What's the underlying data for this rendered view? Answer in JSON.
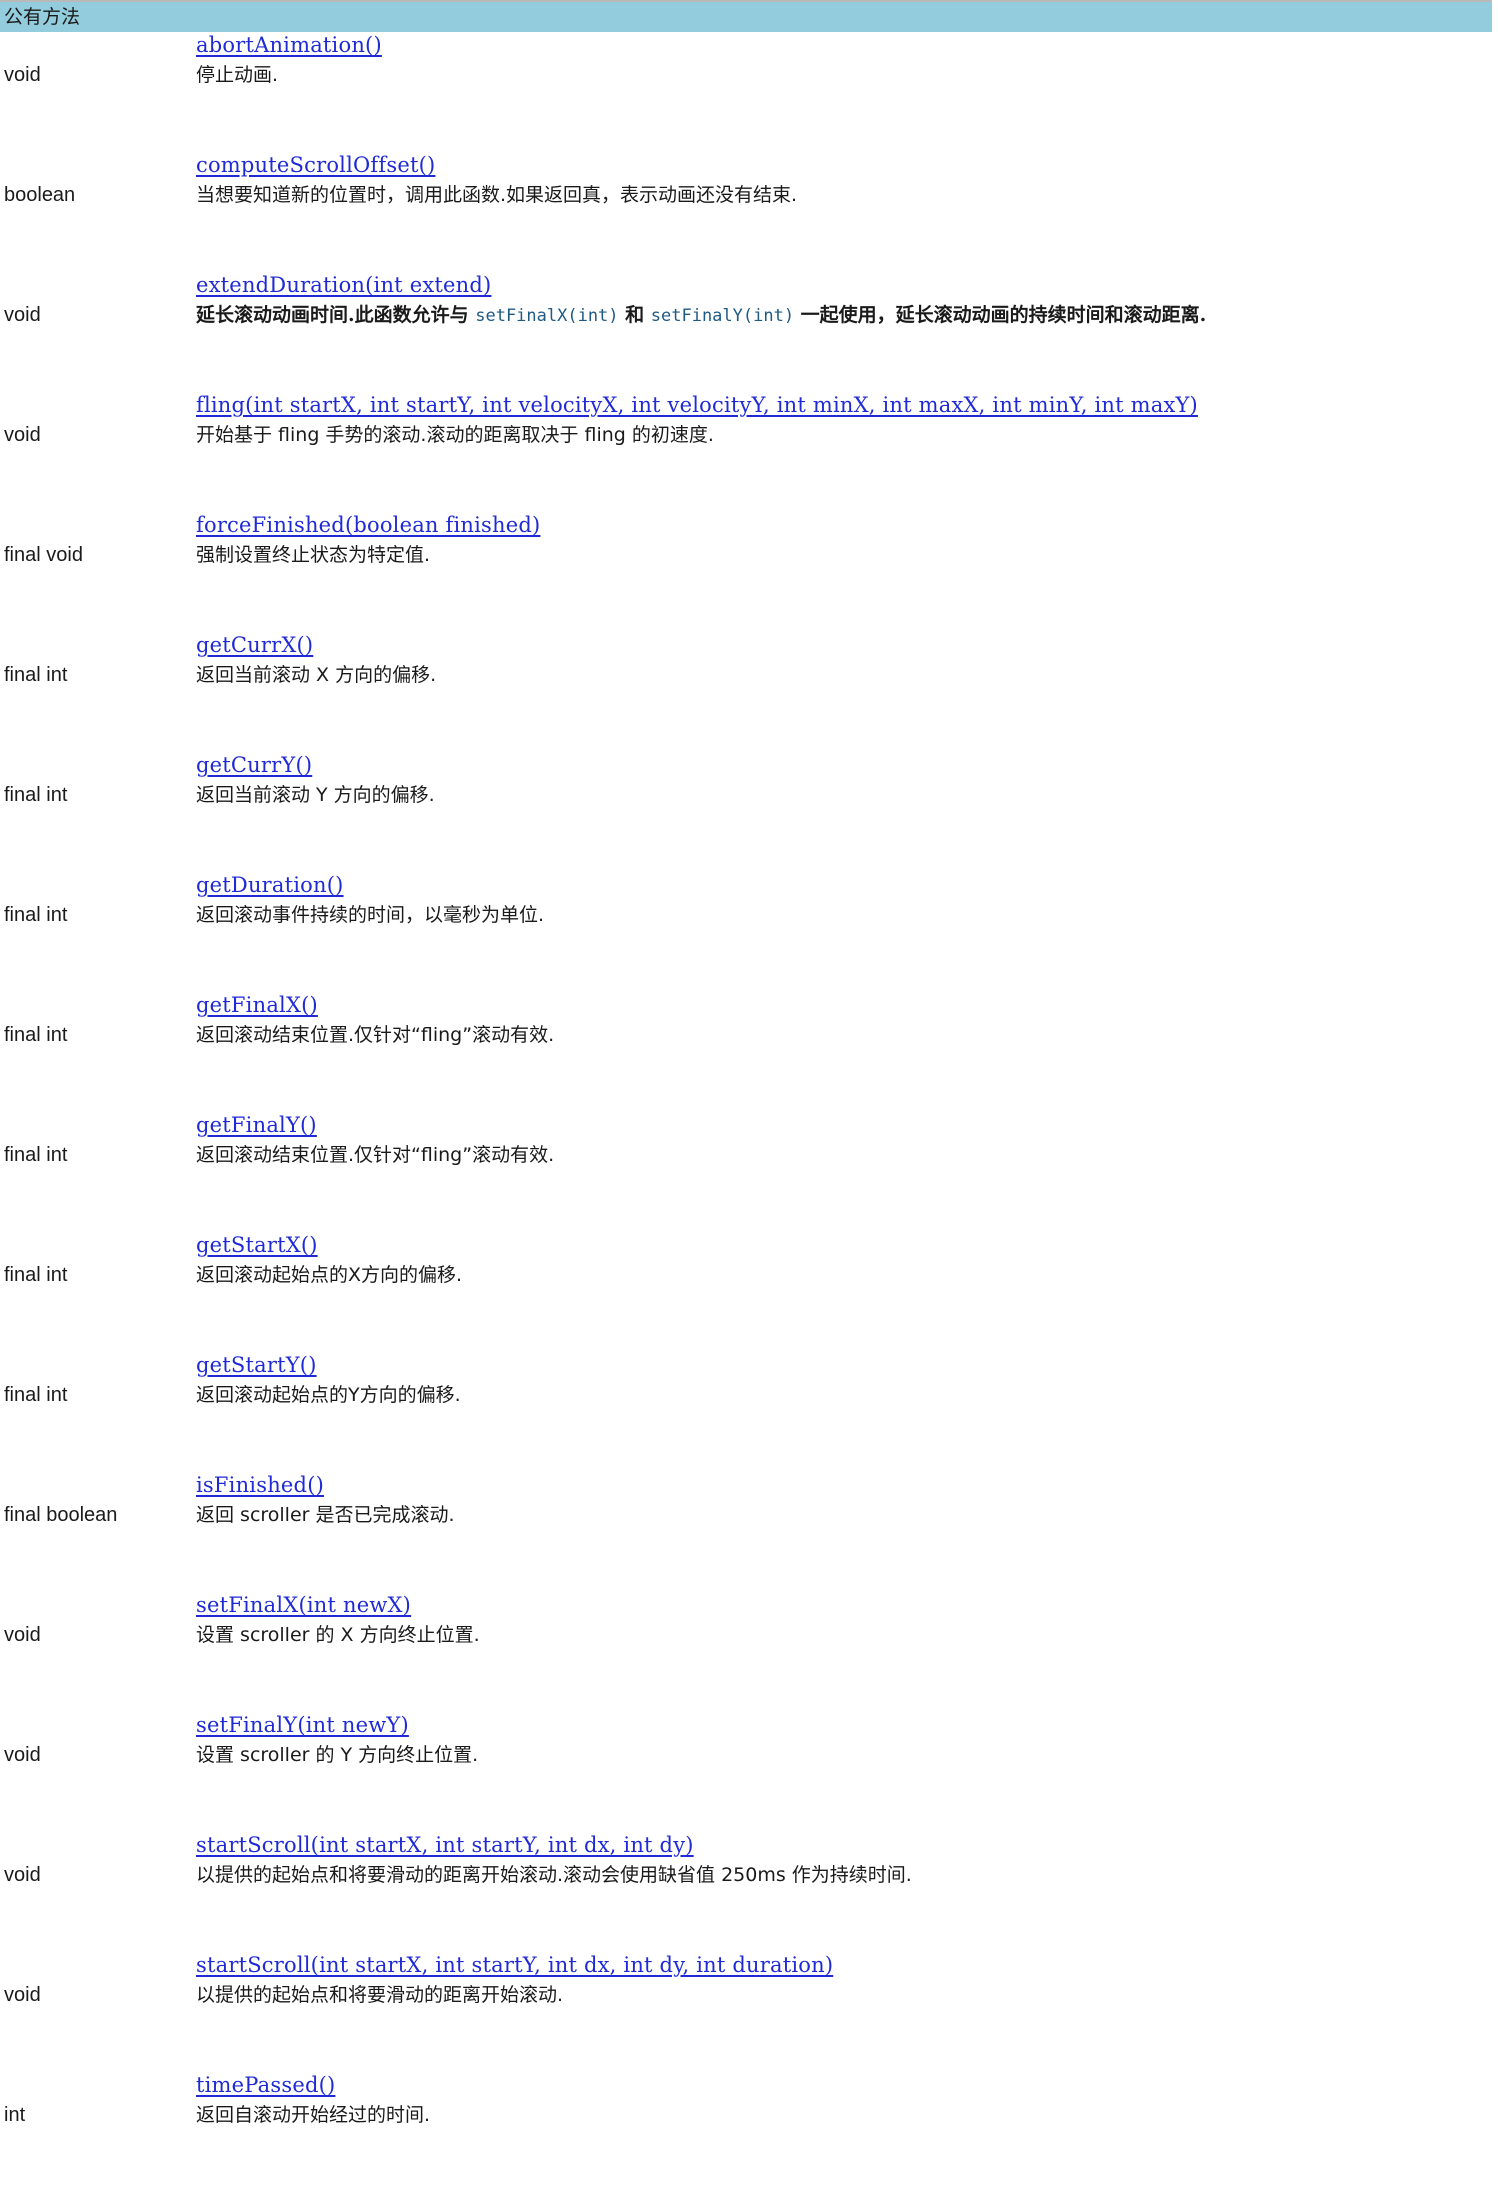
{
  "section_title": "公有方法",
  "methods": [
    {
      "signature": "abortAnimation()",
      "return_type": "void",
      "description": "停止动画."
    },
    {
      "signature": "computeScrollOffset()",
      "return_type": "boolean",
      "description": "当想要知道新的位置时，调用此函数.如果返回真，表示动画还没有结束."
    },
    {
      "signature": "extendDuration(int extend)",
      "return_type": "void",
      "description_parts": {
        "p1": "延长滚动动画时间.此函数允许与 ",
        "code1": "setFinalX(int)",
        "p2": " 和 ",
        "code2": "setFinalY(int)",
        "p3": " 一起使用，延长滚动动画的持续时间和滚动距离."
      }
    },
    {
      "signature": "fling(int startX, int startY, int velocityX, int velocityY, int minX, int maxX, int minY, int maxY)",
      "return_type": "void",
      "description": "开始基于 fling 手势的滚动.滚动的距离取决于 fling 的初速度."
    },
    {
      "signature": "forceFinished(boolean finished)",
      "return_type": "final void",
      "description": "强制设置终止状态为特定值."
    },
    {
      "signature": "getCurrX()",
      "return_type": "final int",
      "description": "返回当前滚动 X 方向的偏移."
    },
    {
      "signature": "getCurrY()",
      "return_type": "final int",
      "description": "返回当前滚动 Y 方向的偏移."
    },
    {
      "signature": "getDuration()",
      "return_type": "final int",
      "description": "返回滚动事件持续的时间，以毫秒为单位."
    },
    {
      "signature": "getFinalX()",
      "return_type": "final int",
      "description": "返回滚动结束位置.仅针对“fling”滚动有效."
    },
    {
      "signature": "getFinalY()",
      "return_type": "final int",
      "description": "返回滚动结束位置.仅针对“fling”滚动有效."
    },
    {
      "signature": "getStartX()",
      "return_type": "final int",
      "description": "返回滚动起始点的X方向的偏移."
    },
    {
      "signature": "getStartY()",
      "return_type": "final int",
      "description": "返回滚动起始点的Y方向的偏移."
    },
    {
      "signature": "isFinished()",
      "return_type": "final boolean",
      "description": "返回 scroller 是否已完成滚动."
    },
    {
      "signature": "setFinalX(int newX)",
      "return_type": "void",
      "description": "设置 scroller 的 X 方向终止位置."
    },
    {
      "signature": "setFinalY(int newY)",
      "return_type": "void",
      "description": "设置 scroller 的 Y 方向终止位置."
    },
    {
      "signature": "startScroll(int startX, int startY, int dx, int dy)",
      "return_type": "void",
      "description": "以提供的起始点和将要滑动的距离开始滚动.滚动会使用缺省值 250ms 作为持续时间."
    },
    {
      "signature": "startScroll(int startX, int startY, int dx, int dy, int duration)",
      "return_type": "void",
      "description": "以提供的起始点和将要滑动的距离开始滚动."
    },
    {
      "signature": "timePassed()",
      "return_type": "int",
      "description": "返回自滚动开始经过的时间."
    }
  ]
}
